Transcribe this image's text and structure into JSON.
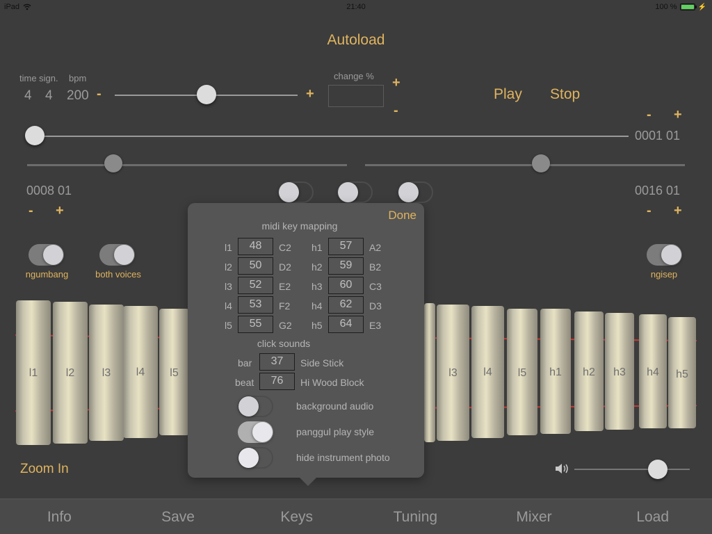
{
  "status_bar": {
    "device": "iPad",
    "time": "21:40",
    "battery": "100 %",
    "battery_level": 1.0,
    "battery_color": "#5fd15f"
  },
  "title": "Autoload",
  "tempo": {
    "time_sign_label": "time sign.",
    "bpm_label": "bpm",
    "beats": "4",
    "unit": "4",
    "bpm": "200",
    "minus": "-",
    "plus": "+",
    "bpm_slider_fraction": 0.5
  },
  "change": {
    "label": "change %",
    "value": "",
    "plus": "+",
    "minus": "-"
  },
  "transport": {
    "play": "Play",
    "stop": "Stop"
  },
  "position": {
    "value": "0001 01",
    "minus": "-",
    "plus": "+",
    "slider_fraction": 0.0
  },
  "loop": {
    "start": {
      "value": "0008 01",
      "minus": "-",
      "plus": "+",
      "slider_fraction": 0.27
    },
    "end": {
      "value": "0016 01",
      "minus": "-",
      "plus": "+",
      "slider_fraction": 0.55
    }
  },
  "mid_switches": [
    {
      "on": false
    },
    {
      "on": false
    },
    {
      "on": false
    }
  ],
  "switches": {
    "ngumbang": {
      "label": "ngumbang",
      "on": true
    },
    "both_voices": {
      "label": "both voices",
      "on": true
    },
    "ngisep": {
      "label": "ngisep",
      "on": true
    }
  },
  "instrument": {
    "bars_left": [
      "l1",
      "l2",
      "l3",
      "l4",
      "l5"
    ],
    "bars_right": [
      "l3",
      "l4",
      "l5",
      "h1",
      "h2",
      "h3",
      "h4",
      "h5"
    ],
    "cord_color": "#c83a34"
  },
  "zoom_button": "Zoom In",
  "volume": {
    "icon": "speaker-icon",
    "fraction": 0.72
  },
  "popover": {
    "done": "Done",
    "mapping_title": "midi key mapping",
    "low_keys": [
      {
        "key": "l1",
        "midi": "48",
        "note": "C2"
      },
      {
        "key": "l2",
        "midi": "50",
        "note": "D2"
      },
      {
        "key": "l3",
        "midi": "52",
        "note": "E2"
      },
      {
        "key": "l4",
        "midi": "53",
        "note": "F2"
      },
      {
        "key": "l5",
        "midi": "55",
        "note": "G2"
      }
    ],
    "high_keys": [
      {
        "key": "h1",
        "midi": "57",
        "note": "A2"
      },
      {
        "key": "h2",
        "midi": "59",
        "note": "B2"
      },
      {
        "key": "h3",
        "midi": "60",
        "note": "C3"
      },
      {
        "key": "h4",
        "midi": "62",
        "note": "D3"
      },
      {
        "key": "h5",
        "midi": "64",
        "note": "E3"
      }
    ],
    "click_title": "click sounds",
    "bar": {
      "label": "bar",
      "midi": "37",
      "sound": "Side Stick"
    },
    "beat": {
      "label": "beat",
      "midi": "76",
      "sound": "Hi Wood Block"
    },
    "options": [
      {
        "label": "background audio",
        "on": false
      },
      {
        "label": "panggul play style",
        "on": true
      },
      {
        "label": "hide instrument photo",
        "on": false
      }
    ]
  },
  "tabs": [
    "Info",
    "Save",
    "Keys",
    "Tuning",
    "Mixer",
    "Load"
  ],
  "colors": {
    "accent": "#e0b45e",
    "background": "#3c3c3c",
    "popover": "#555555",
    "tabbar": "#4a4a4a"
  }
}
